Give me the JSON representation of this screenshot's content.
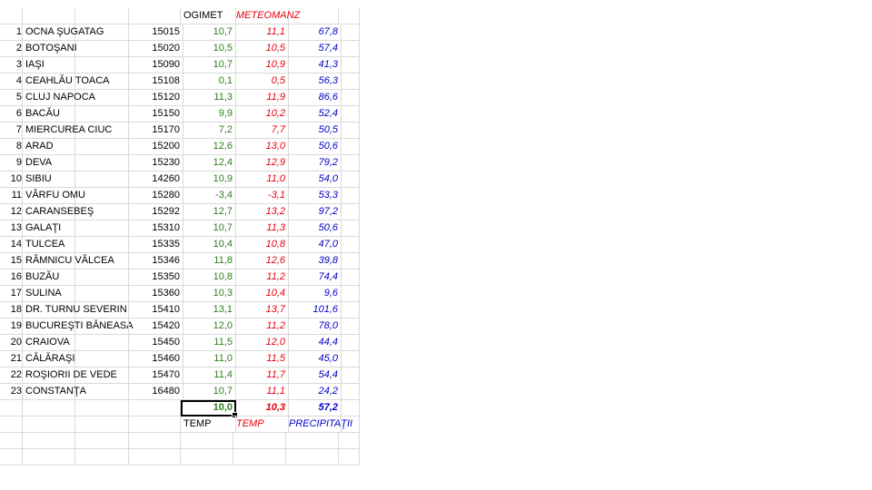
{
  "headers": {
    "ogimet": "OGIMET",
    "meteomanz": "METEOMANZ"
  },
  "rows": [
    {
      "n": "1",
      "station": "OCNA ŞUGATAG",
      "code": "15015",
      "ogimet": "10,7",
      "meteomanz": "11,1",
      "precip": "67,8"
    },
    {
      "n": "2",
      "station": "BOTOŞANI",
      "code": "15020",
      "ogimet": "10,5",
      "meteomanz": "10,5",
      "precip": "57,4"
    },
    {
      "n": "3",
      "station": "IAŞI",
      "code": "15090",
      "ogimet": "10,7",
      "meteomanz": "10,9",
      "precip": "41,3"
    },
    {
      "n": "4",
      "station": "CEAHLĂU TOACA",
      "code": "15108",
      "ogimet": "0,1",
      "meteomanz": "0,5",
      "precip": "56,3"
    },
    {
      "n": "5",
      "station": "CLUJ NAPOCA",
      "code": "15120",
      "ogimet": "11,3",
      "meteomanz": "11,9",
      "precip": "86,6"
    },
    {
      "n": "6",
      "station": "BACĂU",
      "code": "15150",
      "ogimet": "9,9",
      "meteomanz": "10,2",
      "precip": "52,4"
    },
    {
      "n": "7",
      "station": "MIERCUREA CIUC",
      "code": "15170",
      "ogimet": "7,2",
      "meteomanz": "7,7",
      "precip": "50,5"
    },
    {
      "n": "8",
      "station": "ARAD",
      "code": "15200",
      "ogimet": "12,6",
      "meteomanz": "13,0",
      "precip": "50,6"
    },
    {
      "n": "9",
      "station": "DEVA",
      "code": "15230",
      "ogimet": "12,4",
      "meteomanz": "12,9",
      "precip": "79,2"
    },
    {
      "n": "10",
      "station": "SIBIU",
      "code": "14260",
      "ogimet": "10,9",
      "meteomanz": "11,0",
      "precip": "54,0"
    },
    {
      "n": "11",
      "station": "VÂRFU OMU",
      "code": "15280",
      "ogimet": "-3,4",
      "meteomanz": "-3,1",
      "precip": "53,3"
    },
    {
      "n": "12",
      "station": "CARANSEBEŞ",
      "code": "15292",
      "ogimet": "12,7",
      "meteomanz": "13,2",
      "precip": "97,2"
    },
    {
      "n": "13",
      "station": "GALAŢI",
      "code": "15310",
      "ogimet": "10,7",
      "meteomanz": "11,3",
      "precip": "50,6"
    },
    {
      "n": "14",
      "station": "TULCEA",
      "code": "15335",
      "ogimet": "10,4",
      "meteomanz": "10,8",
      "precip": "47,0"
    },
    {
      "n": "15",
      "station": "RÂMNICU VÂLCEA",
      "code": "15346",
      "ogimet": "11,8",
      "meteomanz": "12,6",
      "precip": "39,8"
    },
    {
      "n": "16",
      "station": "BUZĂU",
      "code": "15350",
      "ogimet": "10,8",
      "meteomanz": "11,2",
      "precip": "74,4"
    },
    {
      "n": "17",
      "station": "SULINA",
      "code": "15360",
      "ogimet": "10,3",
      "meteomanz": "10,4",
      "precip": "9,6"
    },
    {
      "n": "18",
      "station": "DR. TURNU SEVERIN",
      "code": "15410",
      "ogimet": "13,1",
      "meteomanz": "13,7",
      "precip": "101,6"
    },
    {
      "n": "19",
      "station": "BUCUREŞTI BĂNEASA",
      "code": "15420",
      "ogimet": "12,0",
      "meteomanz": "11,2",
      "precip": "78,0"
    },
    {
      "n": "20",
      "station": "CRAIOVA",
      "code": "15450",
      "ogimet": "11,5",
      "meteomanz": "12,0",
      "precip": "44,4"
    },
    {
      "n": "21",
      "station": "CĂLĂRAŞI",
      "code": "15460",
      "ogimet": "11,0",
      "meteomanz": "11,5",
      "precip": "45,0"
    },
    {
      "n": "22",
      "station": "ROŞIORII DE VEDE",
      "code": "15470",
      "ogimet": "11,4",
      "meteomanz": "11,7",
      "precip": "54,4"
    },
    {
      "n": "23",
      "station": "CONSTANŢA",
      "code": "16480",
      "ogimet": "10,7",
      "meteomanz": "11,1",
      "precip": "24,2"
    }
  ],
  "totals": {
    "ogimet": "10,0",
    "meteomanz": "10,3",
    "precip": "57,2"
  },
  "footer": {
    "ogimet": "TEMP",
    "meteomanz": "TEMP",
    "precip": "PRECIPITAŢII"
  },
  "colors": {
    "ogimet": "#2e7d1e",
    "meteomanz": "#e8000b",
    "precip": "#0000c8",
    "gridline": "#d9d9d9"
  }
}
